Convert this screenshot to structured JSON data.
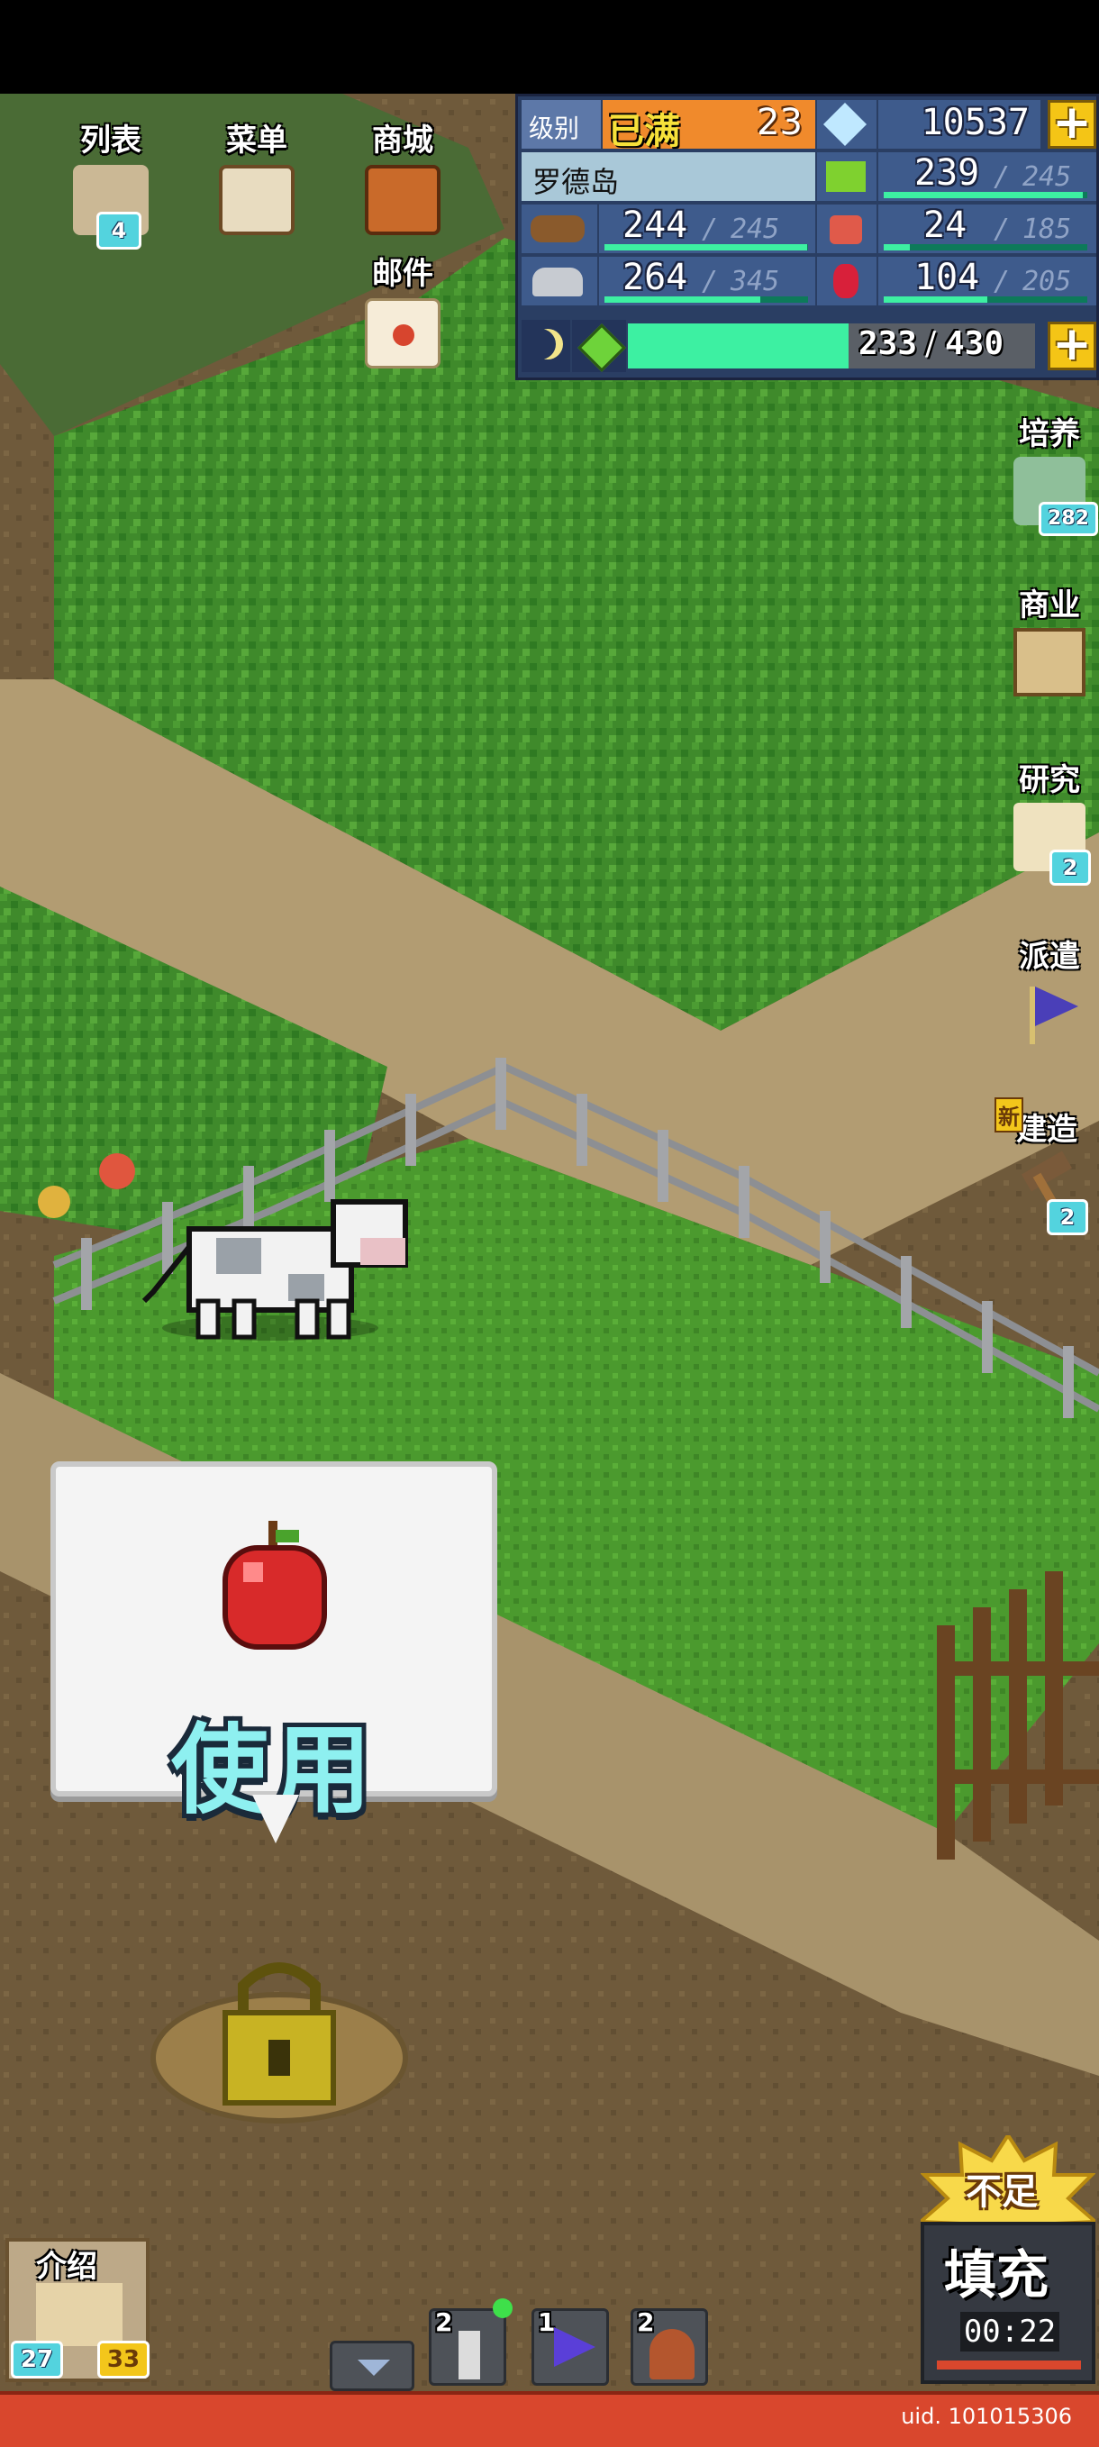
{
  "left_menu": {
    "list": {
      "label": "列表",
      "badge": "4"
    },
    "menu": {
      "label": "菜单"
    },
    "shop": {
      "label": "商城"
    },
    "mail": {
      "label": "邮件"
    }
  },
  "stats": {
    "level_label": "级别",
    "level_status": "已满",
    "level": "23",
    "gems": "10537",
    "island_name": "罗德岛",
    "grass": {
      "value": "239",
      "max": "245",
      "fill": 0.976
    },
    "wood": {
      "value": "244",
      "max": "245",
      "fill": 0.996
    },
    "food": {
      "value": "24",
      "max": "185",
      "fill": 0.13
    },
    "ore": {
      "value": "264",
      "max": "345",
      "fill": 0.765
    },
    "ruby": {
      "value": "104",
      "max": "205",
      "fill": 0.507
    },
    "energy": {
      "value": "233",
      "max": "430",
      "fill": 0.542
    },
    "slash": "/"
  },
  "right_menu": {
    "train": {
      "label": "培养",
      "badge": "282"
    },
    "business": {
      "label": "商业"
    },
    "research": {
      "label": "研究",
      "badge": "2"
    },
    "dispatch": {
      "label": "派遣"
    },
    "build": {
      "label": "建造",
      "badge": "2",
      "new_tag": "新"
    }
  },
  "use_bubble": {
    "label": "使用"
  },
  "intro": {
    "label": "介绍",
    "badge_left": "27",
    "badge_right": "33"
  },
  "toolbar": {
    "slot1_count": "2",
    "slot2_count": "1",
    "slot3_count": "2"
  },
  "refill": {
    "burst_label": "不足",
    "label": "填充",
    "timer": "00:22"
  },
  "footer": {
    "uid": "uid. 101015306"
  },
  "colors": {
    "panel": "#2a3e63",
    "accent_gold": "#f4c516",
    "bar": "#3df0a2",
    "bubble_text": "#8ef0f0"
  }
}
